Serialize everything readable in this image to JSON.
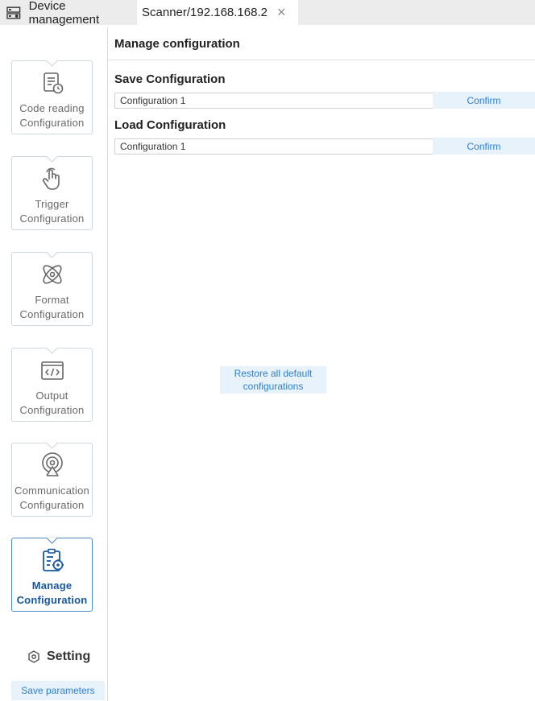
{
  "tabs": {
    "device_label": "Device management",
    "scanner_label": "Scanner/192.168.168.2",
    "close_glyph": "×"
  },
  "sidebar": {
    "items": [
      {
        "label1": "Code reading",
        "label2": "Configuration",
        "icon": "document-clock-icon"
      },
      {
        "label1": "Trigger",
        "label2": "Configuration",
        "icon": "hand-pointer-icon"
      },
      {
        "label1": "Format",
        "label2": "Configuration",
        "icon": "atom-icon"
      },
      {
        "label1": "Output",
        "label2": "Configuration",
        "icon": "code-window-icon"
      },
      {
        "label1": "Communication",
        "label2": "Configuration",
        "icon": "signal-icon"
      },
      {
        "label1": "Manage",
        "label2": "Configuration",
        "icon": "clipboard-gear-icon",
        "active": true
      }
    ],
    "setting_label": "Setting",
    "save_params_label": "Save parameters"
  },
  "main": {
    "page_title": "Manage configuration",
    "save_section": {
      "title": "Save Configuration",
      "selected": "Configuration 1",
      "confirm_label": "Confirm"
    },
    "load_section": {
      "title": "Load Configuration",
      "selected": "Configuration 1",
      "confirm_label": "Confirm"
    },
    "restore_line1": "Restore all default",
    "restore_line2": "configurations"
  },
  "colors": {
    "accent": "#2e7fd0",
    "active_border": "#4d8ac8",
    "button_bg": "#e8f2fb"
  }
}
